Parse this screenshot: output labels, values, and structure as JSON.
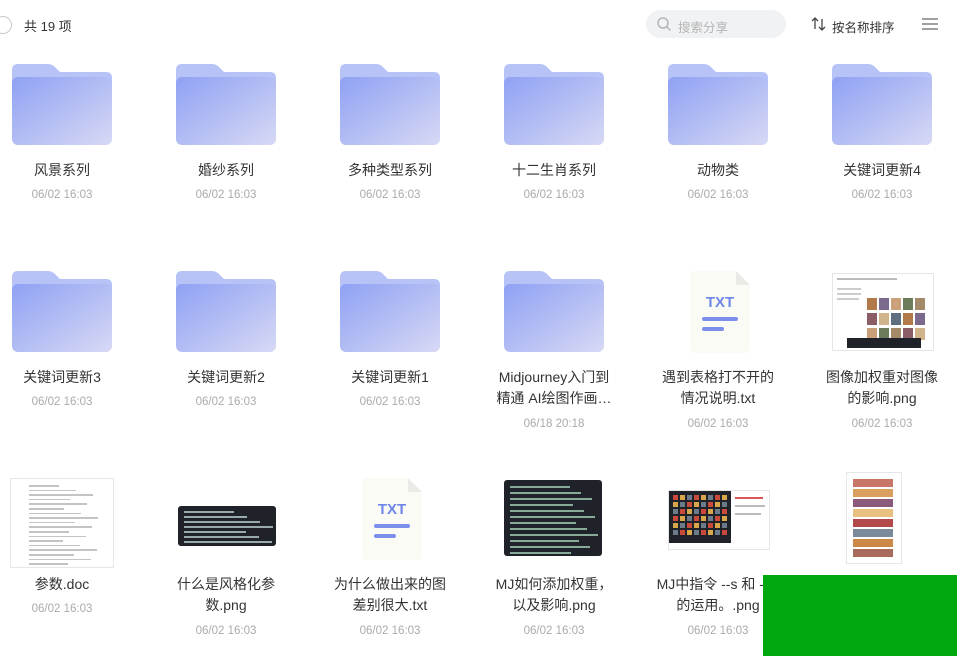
{
  "header": {
    "count_label": "共 19 项",
    "search_placeholder": "搜索分享",
    "sort_label": "按名称排序"
  },
  "items": [
    {
      "name": "风景系列",
      "date": "06/02 16:03",
      "type": "folder"
    },
    {
      "name": "婚纱系列",
      "date": "06/02 16:03",
      "type": "folder"
    },
    {
      "name": "多种类型系列",
      "date": "06/02 16:03",
      "type": "folder"
    },
    {
      "name": "十二生肖系列",
      "date": "06/02 16:03",
      "type": "folder"
    },
    {
      "name": "动物类",
      "date": "06/02 16:03",
      "type": "folder"
    },
    {
      "name": "关键词更新4",
      "date": "06/02 16:03",
      "type": "folder"
    },
    {
      "name": "关键词更新3",
      "date": "06/02 16:03",
      "type": "folder"
    },
    {
      "name": "关键词更新2",
      "date": "06/02 16:03",
      "type": "folder"
    },
    {
      "name": "关键词更新1",
      "date": "06/02 16:03",
      "type": "folder"
    },
    {
      "name": "Midjourney入门到精通 AI绘图作画…",
      "date": "06/18 20:18",
      "type": "folder"
    },
    {
      "name": "遇到表格打不开的情况说明.txt",
      "date": "06/02 16:03",
      "type": "txt"
    },
    {
      "name": "图像加权重对图像的影响.png",
      "date": "06/02 16:03",
      "type": "image-grid"
    },
    {
      "name": "参数.doc",
      "date": "06/02 16:03",
      "type": "doc"
    },
    {
      "name": "什么是风格化参数.png",
      "date": "06/02 16:03",
      "type": "image-dark-wide"
    },
    {
      "name": "为什么做出来的图差别很大.txt",
      "date": "06/02 16:03",
      "type": "txt"
    },
    {
      "name": "MJ如何添加权重，以及影响.png",
      "date": "06/02 16:03",
      "type": "image-dark"
    },
    {
      "name": "MJ中指令 --s 和 -- c 的运用。.png",
      "date": "06/02 16:03",
      "type": "image-mixed"
    },
    {
      "name": "",
      "date": "",
      "type": "image-strips"
    }
  ],
  "txt_badge": "TXT",
  "colors": {
    "folder_front": "#a7b6f7",
    "folder_back": "#b9c5f8",
    "overlay": "#00a80f"
  }
}
